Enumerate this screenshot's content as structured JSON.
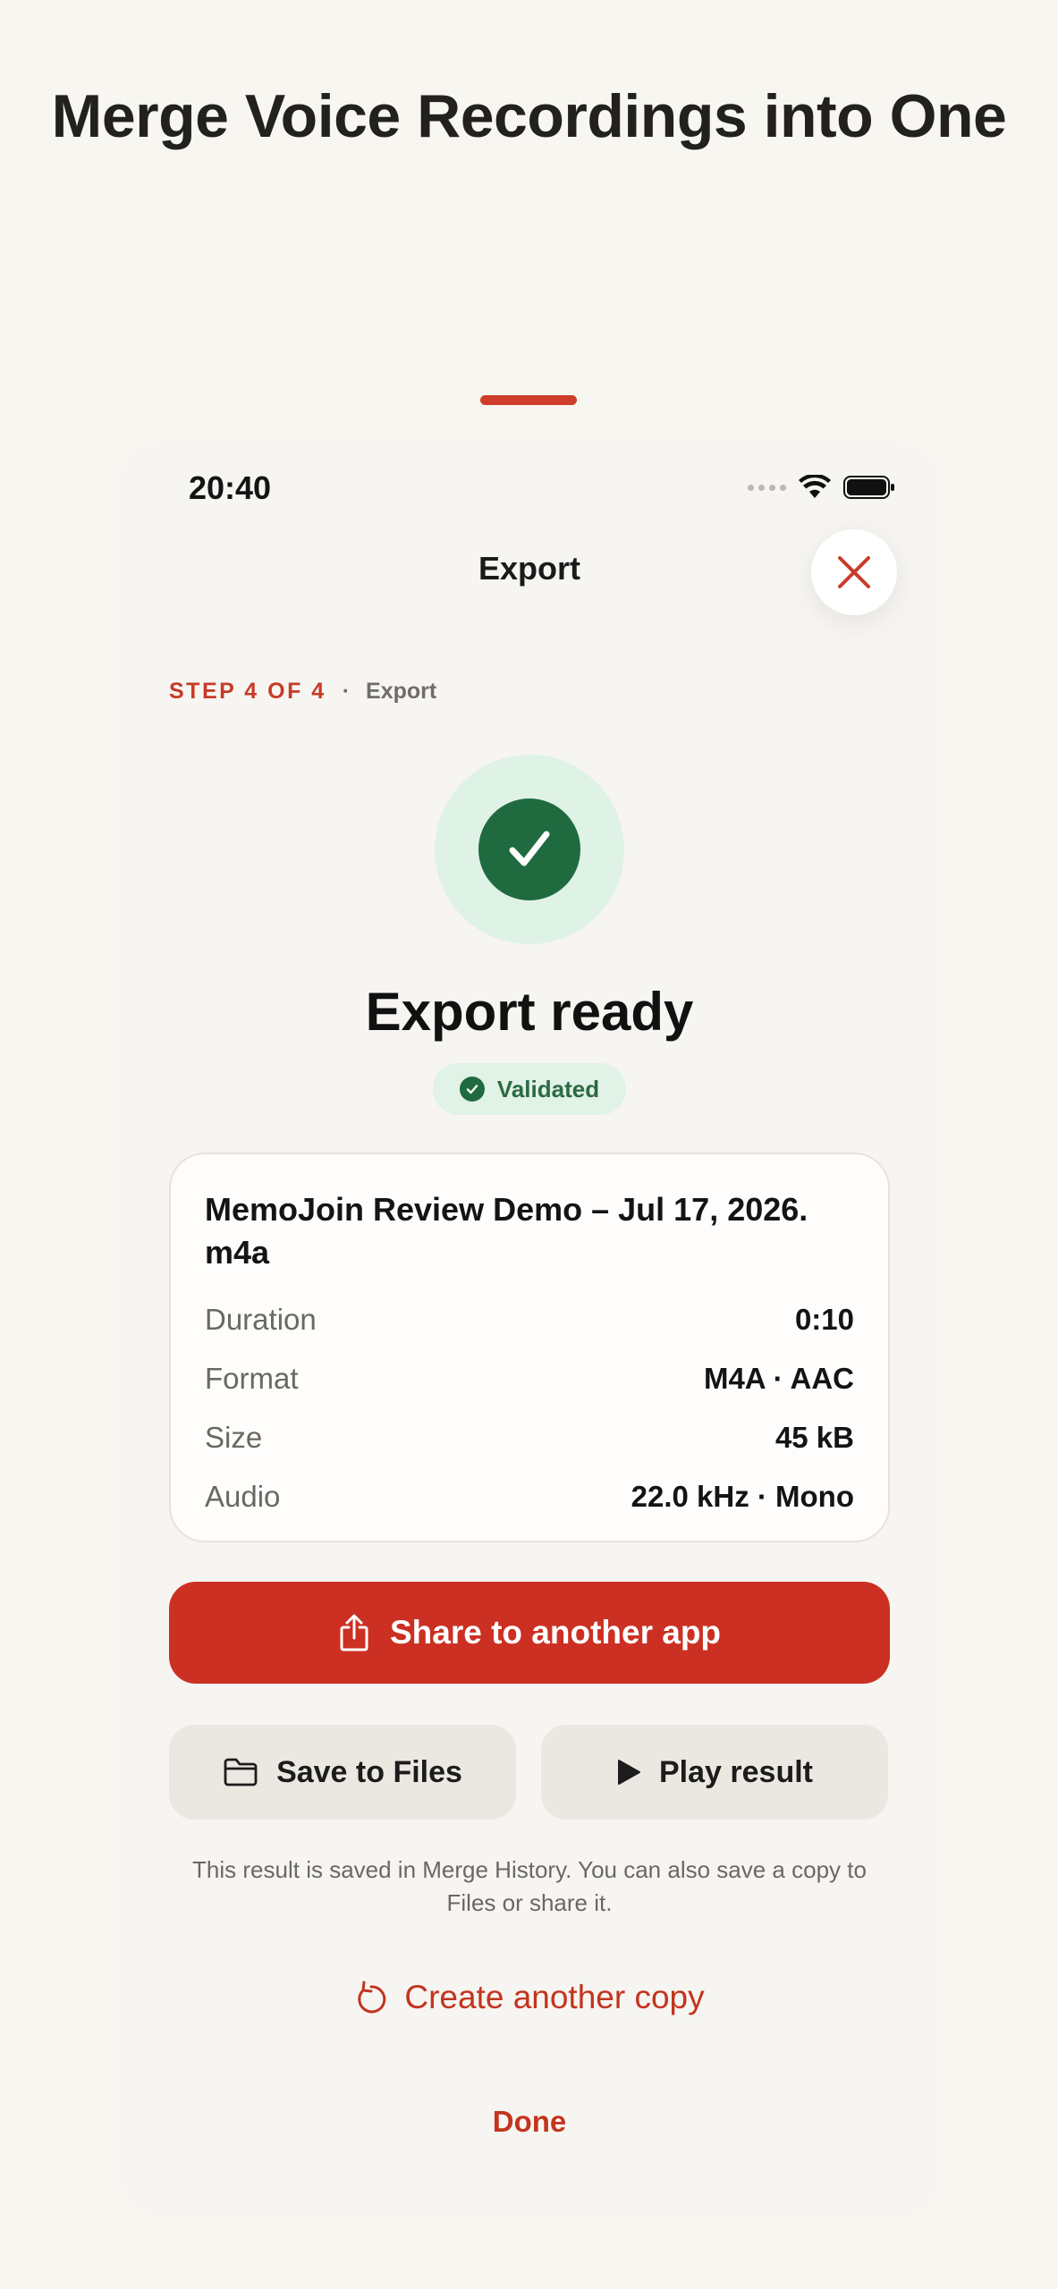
{
  "headline": "Merge Voice Recordings into One",
  "status_bar": {
    "time": "20:40"
  },
  "nav": {
    "title": "Export"
  },
  "step": {
    "label": "STEP 4 OF 4",
    "separator": "·",
    "name": "Export"
  },
  "result": {
    "title": "Export ready",
    "badge": "Validated"
  },
  "file": {
    "name": "MemoJoin Review Demo – Jul 17, 2026.",
    "name_line2": "m4a",
    "rows": [
      {
        "label": "Duration",
        "value": "0:10"
      },
      {
        "label": "Format",
        "value": "M4A · AAC"
      },
      {
        "label": "Size",
        "value": "45 kB"
      },
      {
        "label": "Audio",
        "value": "22.0 kHz · Mono"
      }
    ]
  },
  "actions": {
    "share": "Share to another app",
    "save": "Save to Files",
    "play": "Play result"
  },
  "hint": "This result is saved in Merge History. You can also save a copy to Files or share it.",
  "create_copy": "Create another copy",
  "done": "Done",
  "icons": {
    "close": "close-icon",
    "success": "checkmark-icon",
    "share": "share-icon",
    "folder": "folder-icon",
    "play": "play-icon",
    "repeat": "rotate-icon"
  },
  "colors": {
    "accent": "#cb3022",
    "success": "#1f6b3f",
    "success_bg": "#dff2e6",
    "background": "#f8f6f1"
  }
}
